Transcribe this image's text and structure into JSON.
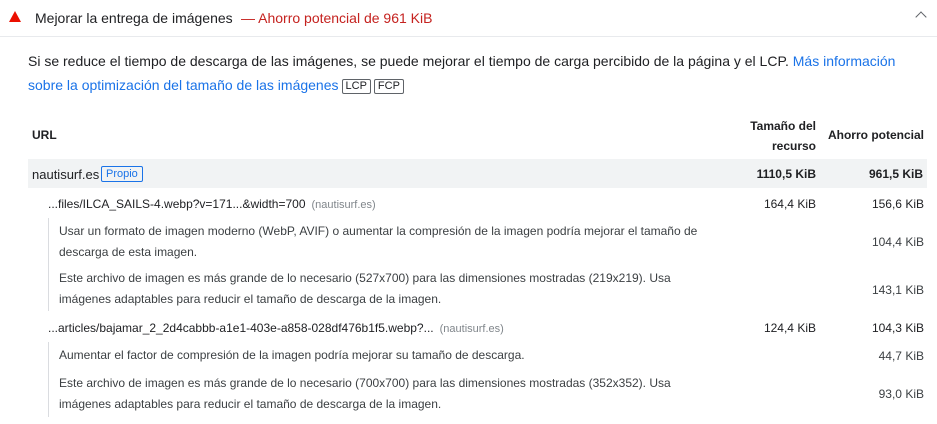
{
  "header": {
    "title": "Mejorar la entrega de imágenes",
    "savings": "— Ahorro potencial de 961 KiB",
    "status_color": "#eb0f00"
  },
  "description": {
    "text": "Si se reduce el tiempo de descarga de las imágenes, se puede mejorar el tiempo de carga percibido de la página y el LCP. ",
    "link": "Más información sobre la optimización del tamaño de las imágenes",
    "tags": [
      "LCP",
      "FCP"
    ]
  },
  "table": {
    "columns": {
      "url": "URL",
      "size_line1": "Tamaño del",
      "size_line2": "recurso",
      "savings": "Ahorro potencial"
    },
    "group": {
      "name": "nautisurf.es",
      "badge": "Propio",
      "size": "1110,5 KiB",
      "savings": "961,5 KiB"
    },
    "rows": [
      {
        "url": "...files/ILCA_SAILS-4.webp?v=171...&width=700",
        "host": "(nautisurf.es)",
        "size": "164,4 KiB",
        "savings": "156,6 KiB",
        "subitems": [
          {
            "text": "Usar un formato de imagen moderno (WebP, AVIF) o aumentar la compresión de la imagen podría mejorar el tamaño de descarga de esta imagen.",
            "savings": "104,4 KiB"
          },
          {
            "text": "Este archivo de imagen es más grande de lo necesario (527x700) para las dimensiones mostradas (219x219). Usa imágenes adaptables para reducir el tamaño de descarga de la imagen.",
            "savings": "143,1 KiB"
          }
        ]
      },
      {
        "url": "...articles/bajamar_2_2d4cabbb-a1e1-403e-a858-028df476b1f5.webp?...",
        "host": "(nautisurf.es)",
        "size": "124,4 KiB",
        "savings": "104,3 KiB",
        "subitems": [
          {
            "text": "Aumentar el factor de compresión de la imagen podría mejorar su tamaño de descarga.",
            "savings": "44,7 KiB"
          },
          {
            "text": "Este archivo de imagen es más grande de lo necesario (700x700) para las dimensiones mostradas (352x352). Usa imágenes adaptables para reducir el tamaño de descarga de la imagen.",
            "savings": "93,0 KiB"
          }
        ]
      }
    ]
  }
}
